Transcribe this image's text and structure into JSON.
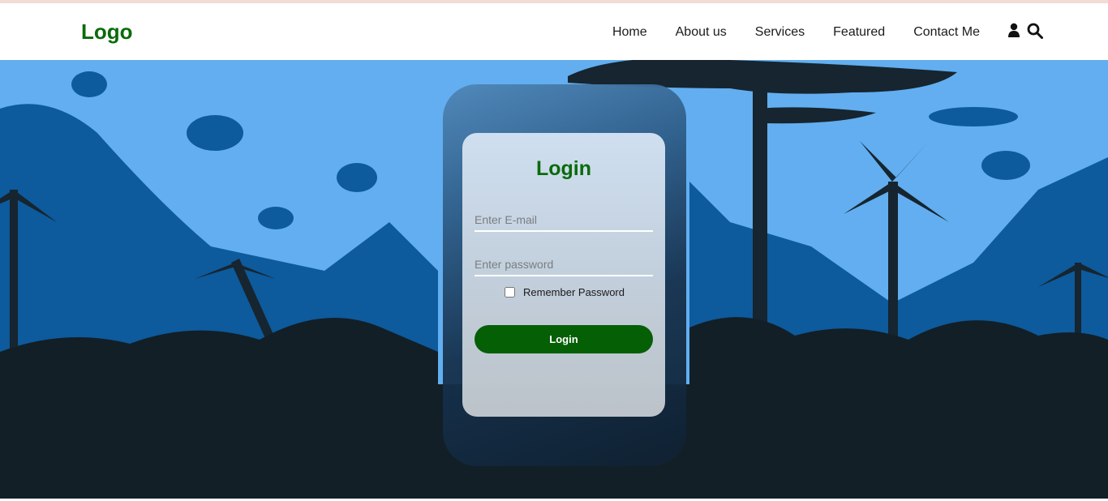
{
  "header": {
    "logo": "Logo",
    "nav": [
      {
        "label": "Home"
      },
      {
        "label": "About us"
      },
      {
        "label": "Services"
      },
      {
        "label": "Featured"
      },
      {
        "label": "Contact Me"
      }
    ],
    "icons": [
      "user-icon",
      "search-icon"
    ]
  },
  "login": {
    "title": "Login",
    "email_placeholder": "Enter E-mail",
    "password_placeholder": "Enter password",
    "remember_label": "Remember Password",
    "remember_checked": false,
    "button_label": "Login"
  },
  "colors": {
    "brand_green": "#0a6b0a",
    "button_green": "#055f05",
    "sky": "#62aef0",
    "ground": "#121f27"
  }
}
